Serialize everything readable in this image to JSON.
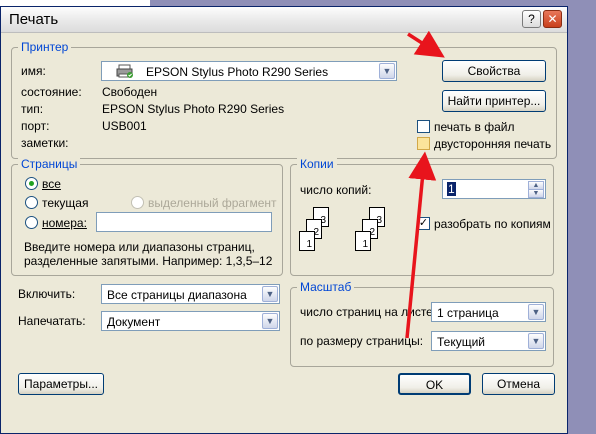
{
  "window": {
    "title": "Печать",
    "help_glyph": "?",
    "close_glyph": "✕"
  },
  "printer": {
    "legend": "Принтер",
    "name_label": "имя:",
    "name_value": "EPSON Stylus Photo R290 Series",
    "status_label": "состояние:",
    "status_value": "Свободен",
    "type_label": "тип:",
    "type_value": "EPSON Stylus Photo R290 Series",
    "port_label": "порт:",
    "port_value": "USB001",
    "notes_label": "заметки:",
    "properties_button": "Свойства",
    "find_printer_button": "Найти принтер...",
    "print_to_file": "печать в файл",
    "duplex": "двусторонняя печать"
  },
  "pages": {
    "legend": "Страницы",
    "all": "все",
    "current": "текущая",
    "selection": "выделенный фрагмент",
    "numbers": "номера:",
    "hint": "Введите номера или диапазоны страниц, разделенные запятыми. Например: 1,3,5–12"
  },
  "copies": {
    "legend": "Копии",
    "count_label": "число копий:",
    "count_value": "1",
    "collate": "разобрать по копиям",
    "collate_checked": "✓",
    "page_numbers": [
      "1",
      "2",
      "3"
    ]
  },
  "include": {
    "label": "Включить:",
    "value": "Все страницы диапазона"
  },
  "print_what": {
    "label": "Напечатать:",
    "value": "Документ"
  },
  "scale": {
    "legend": "Масштаб",
    "pages_per_sheet_label": "число страниц на листе:",
    "pages_per_sheet_value": "1 страница",
    "fit_label": "по размеру страницы:",
    "fit_value": "Текущий"
  },
  "footer": {
    "options_button": "Параметры...",
    "ok_button": "OK",
    "cancel_button": "Отмена"
  },
  "colors": {
    "dialog_bg": "#ece9d8",
    "legend_text": "#0046d5",
    "annotation_arrow": "#e8141c",
    "backdrop": "#8f8fb7"
  }
}
